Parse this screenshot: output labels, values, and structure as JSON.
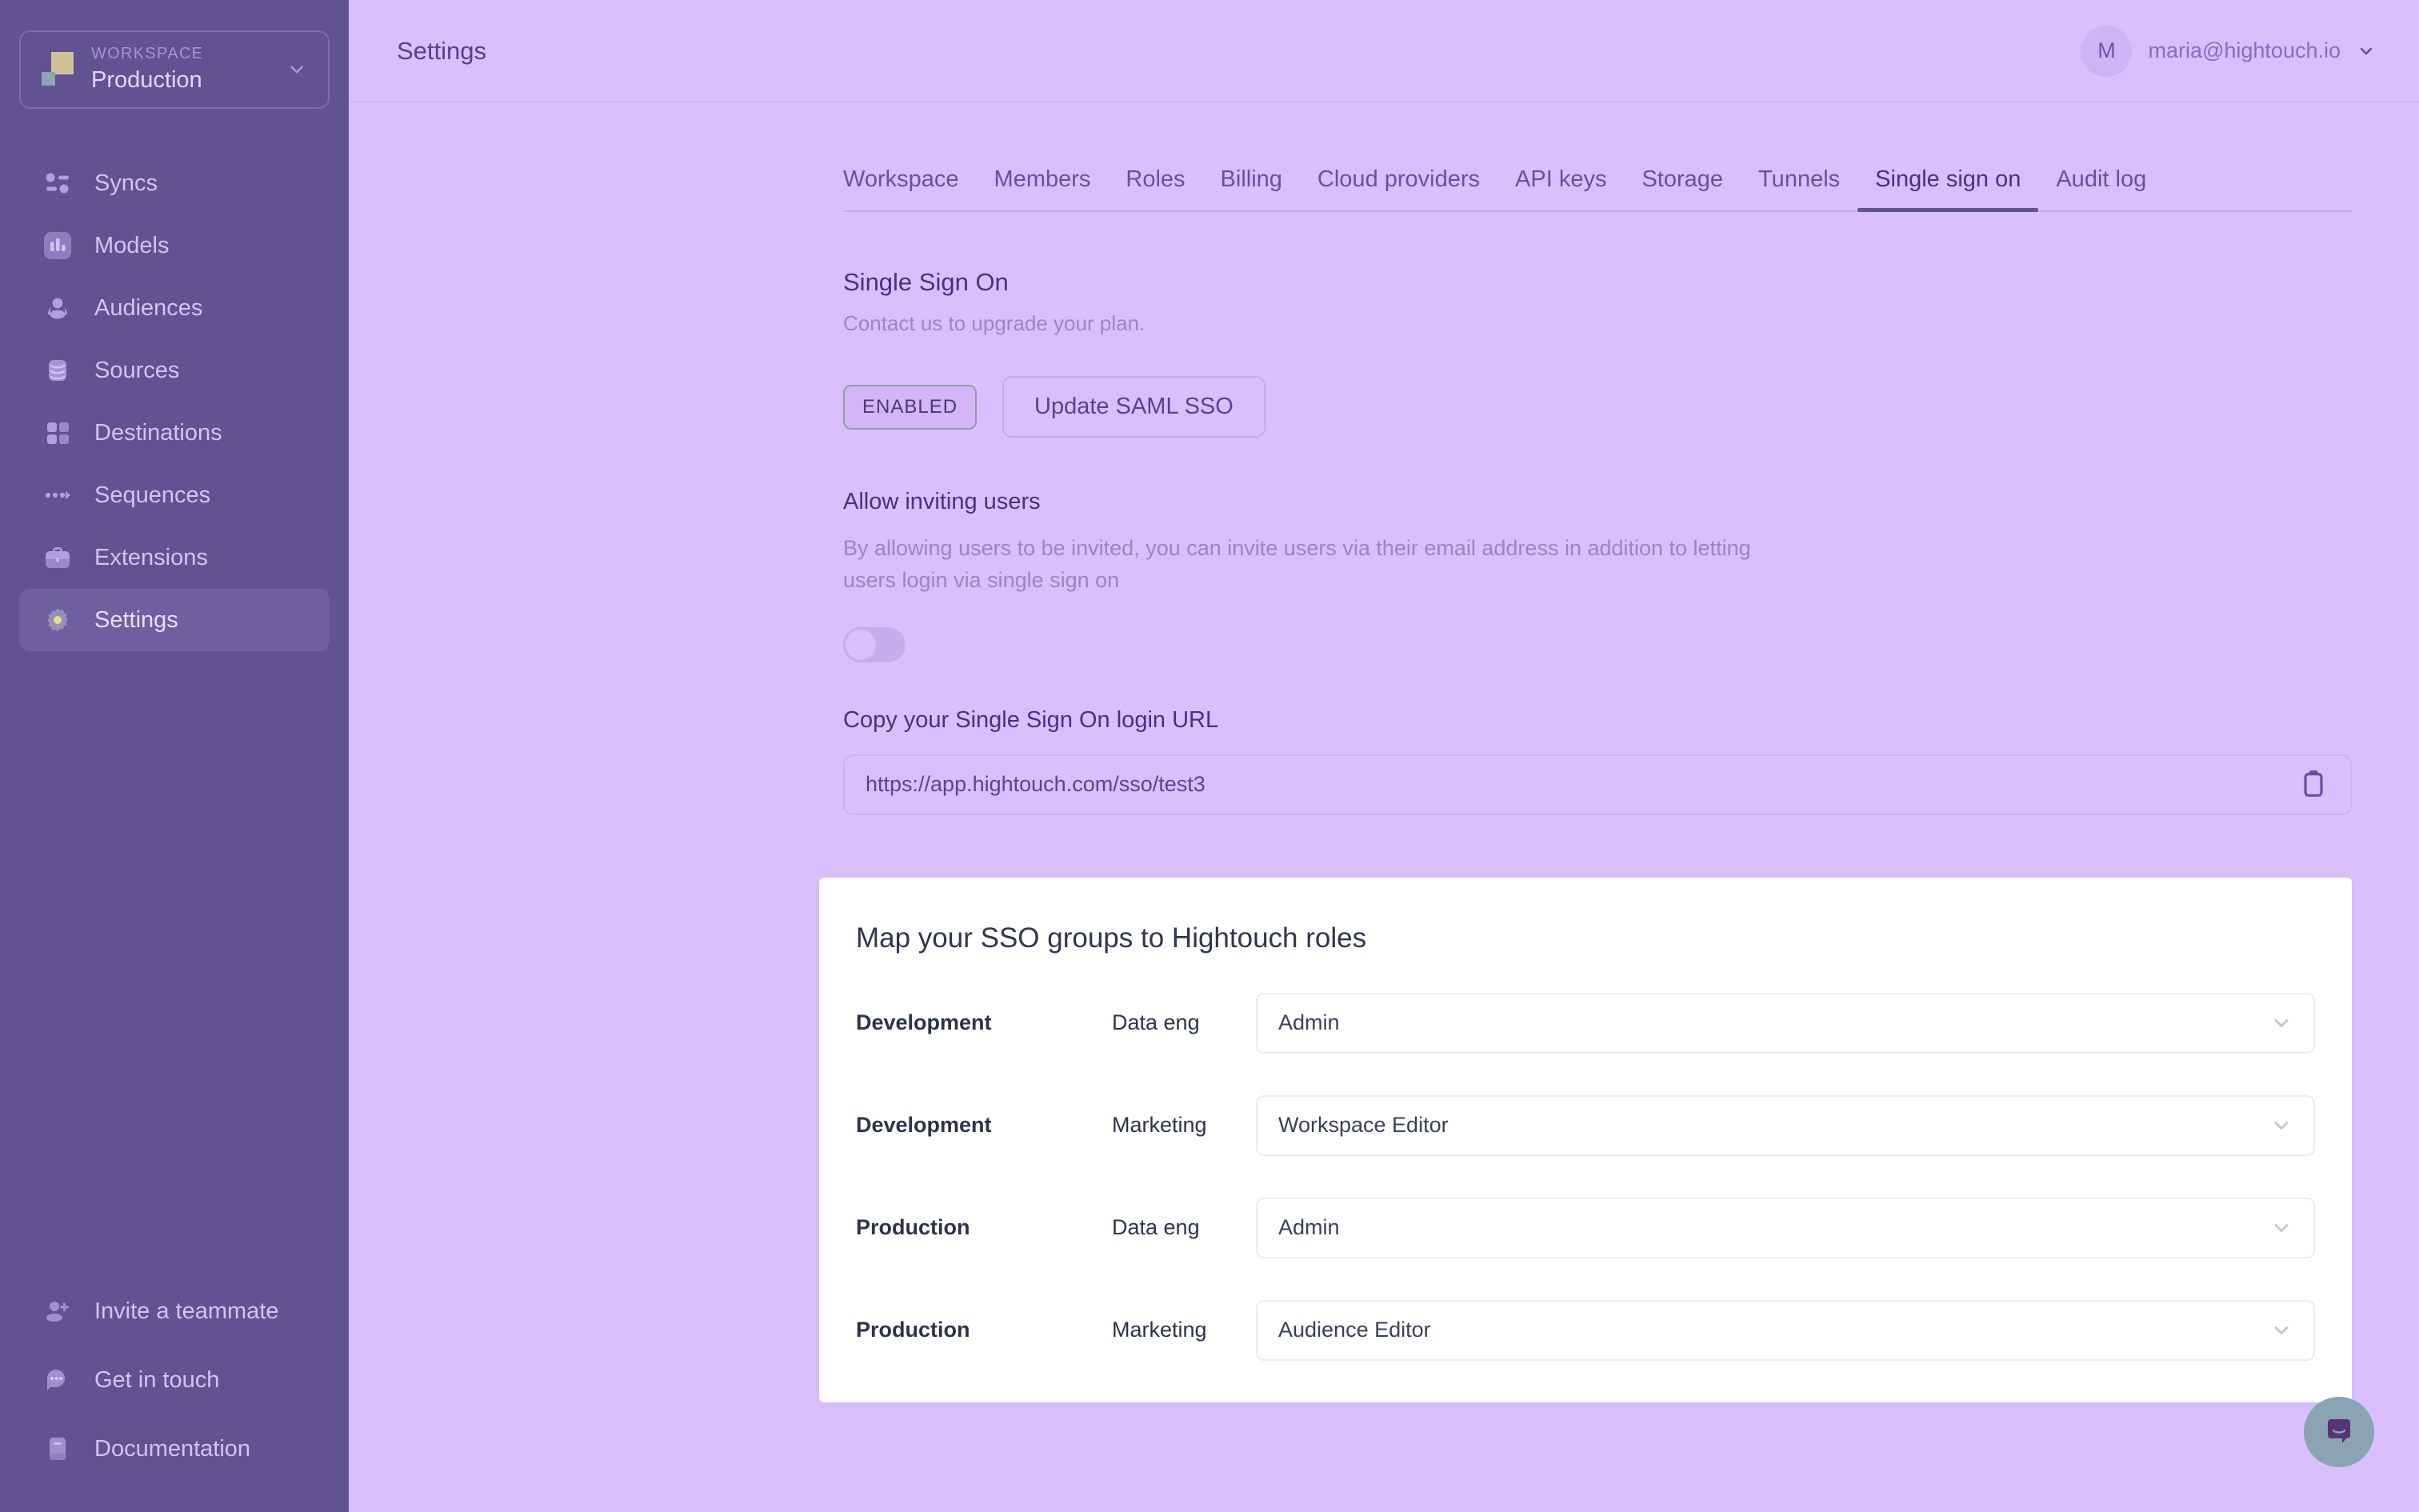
{
  "sidebar": {
    "workspace": {
      "label": "WORKSPACE",
      "name": "Production",
      "chevron_icon": "chevron-down-icon"
    },
    "items": [
      {
        "label": "Syncs",
        "icon": "syncs-icon",
        "active": false
      },
      {
        "label": "Models",
        "icon": "models-icon",
        "active": false
      },
      {
        "label": "Audiences",
        "icon": "audiences-icon",
        "active": false
      },
      {
        "label": "Sources",
        "icon": "sources-icon",
        "active": false
      },
      {
        "label": "Destinations",
        "icon": "destinations-icon",
        "active": false
      },
      {
        "label": "Sequences",
        "icon": "sequences-icon",
        "active": false
      },
      {
        "label": "Extensions",
        "icon": "extensions-icon",
        "active": false
      },
      {
        "label": "Settings",
        "icon": "gear-icon",
        "active": true
      }
    ],
    "bottom_items": [
      {
        "label": "Invite a teammate",
        "icon": "user-plus-icon"
      },
      {
        "label": "Get in touch",
        "icon": "chat-dots-icon"
      },
      {
        "label": "Documentation",
        "icon": "book-icon"
      }
    ]
  },
  "topbar": {
    "title": "Settings",
    "avatar_initial": "M",
    "user_email": "maria@hightouch.io",
    "chevron_icon": "chevron-down-icon"
  },
  "tabs": [
    {
      "label": "Workspace",
      "active": false
    },
    {
      "label": "Members",
      "active": false
    },
    {
      "label": "Roles",
      "active": false
    },
    {
      "label": "Billing",
      "active": false
    },
    {
      "label": "Cloud providers",
      "active": false
    },
    {
      "label": "API keys",
      "active": false
    },
    {
      "label": "Storage",
      "active": false
    },
    {
      "label": "Tunnels",
      "active": false
    },
    {
      "label": "Single sign on",
      "active": true
    },
    {
      "label": "Audit log",
      "active": false
    }
  ],
  "sso": {
    "title": "Single Sign On",
    "subtitle": "Contact us to upgrade your plan.",
    "status_badge": "ENABLED",
    "update_button": "Update SAML SSO",
    "invite_title": "Allow inviting users",
    "invite_description": "By allowing users to be invited, you can invite users via their email address in addition to letting users login via single sign on",
    "invite_toggle_state": "off",
    "url_label": "Copy your Single Sign On login URL",
    "url_value": "https://app.hightouch.com/sso/test3",
    "copy_icon": "clipboard-icon"
  },
  "mapping_card": {
    "title": "Map your SSO groups to Hightouch roles",
    "rows": [
      {
        "group": "Development",
        "subgroup": "Data eng",
        "role": "Admin"
      },
      {
        "group": "Development",
        "subgroup": "Marketing",
        "role": "Workspace Editor"
      },
      {
        "group": "Production",
        "subgroup": "Data eng",
        "role": "Admin"
      },
      {
        "group": "Production",
        "subgroup": "Marketing",
        "role": "Audience Editor"
      }
    ],
    "chevron_icon": "chevron-down-icon"
  },
  "chat_widget": {
    "icon": "chat-bubble-icon"
  },
  "colors": {
    "sidebar_bg": "#615293",
    "content_bg": "#d9bffb",
    "accent": "#5f5390",
    "card_bg": "#ffffff",
    "text_dark": "#30374f"
  }
}
